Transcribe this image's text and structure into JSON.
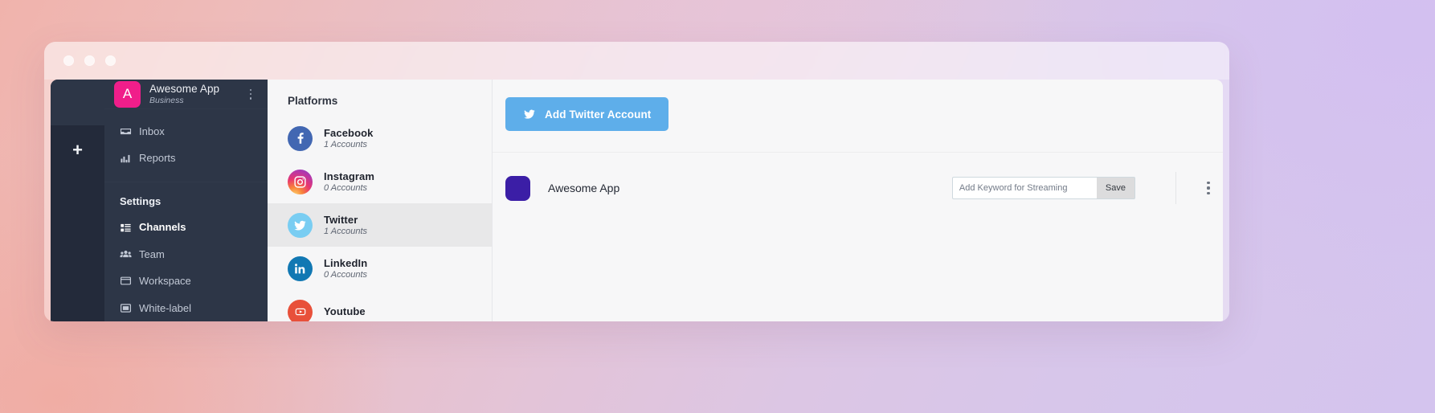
{
  "window": {
    "traffic_lights": [
      "close",
      "minimize",
      "maximize"
    ]
  },
  "sidebar": {
    "rail": {
      "add_label": "+"
    },
    "workspace": {
      "logo_letter": "A",
      "logo_color": "#f01e8a",
      "name": "Awesome App",
      "plan": "Business",
      "menu_icon": "kebab-menu-icon"
    },
    "nav": [
      {
        "label": "Inbox",
        "icon": "inbox-icon",
        "active": false
      },
      {
        "label": "Reports",
        "icon": "chart-icon",
        "active": false
      }
    ],
    "settings_title": "Settings",
    "settings": [
      {
        "label": "Channels",
        "icon": "channels-icon",
        "active": true
      },
      {
        "label": "Team",
        "icon": "team-icon",
        "active": false
      },
      {
        "label": "Workspace",
        "icon": "workspace-icon",
        "active": false
      },
      {
        "label": "White-label",
        "icon": "whitelabel-icon",
        "active": false
      }
    ]
  },
  "platforms": {
    "title": "Platforms",
    "items": [
      {
        "name": "Facebook",
        "accounts": "1 Accounts",
        "icon": "facebook-icon",
        "color": "#4267b2",
        "selected": false
      },
      {
        "name": "Instagram",
        "accounts": "0 Accounts",
        "icon": "instagram-icon",
        "color": "#e8376f",
        "selected": false
      },
      {
        "name": "Twitter",
        "accounts": "1 Accounts",
        "icon": "twitter-icon",
        "color": "#79cdf2",
        "selected": true
      },
      {
        "name": "LinkedIn",
        "accounts": "0 Accounts",
        "icon": "linkedin-icon",
        "color": "#1178b3",
        "selected": false
      },
      {
        "name": "Youtube",
        "accounts": "",
        "icon": "youtube-icon",
        "color": "#e8503a",
        "selected": false
      }
    ]
  },
  "content": {
    "add_button": {
      "label": "Add Twitter Account",
      "icon": "twitter-icon",
      "color": "#5eaeea"
    },
    "accounts": [
      {
        "name": "Awesome App",
        "avatar_color": "#3b1ea6",
        "keyword_placeholder": "Add Keyword for Streaming",
        "keyword_value": "",
        "save_label": "Save",
        "menu_icon": "kebab-menu-icon"
      }
    ]
  }
}
